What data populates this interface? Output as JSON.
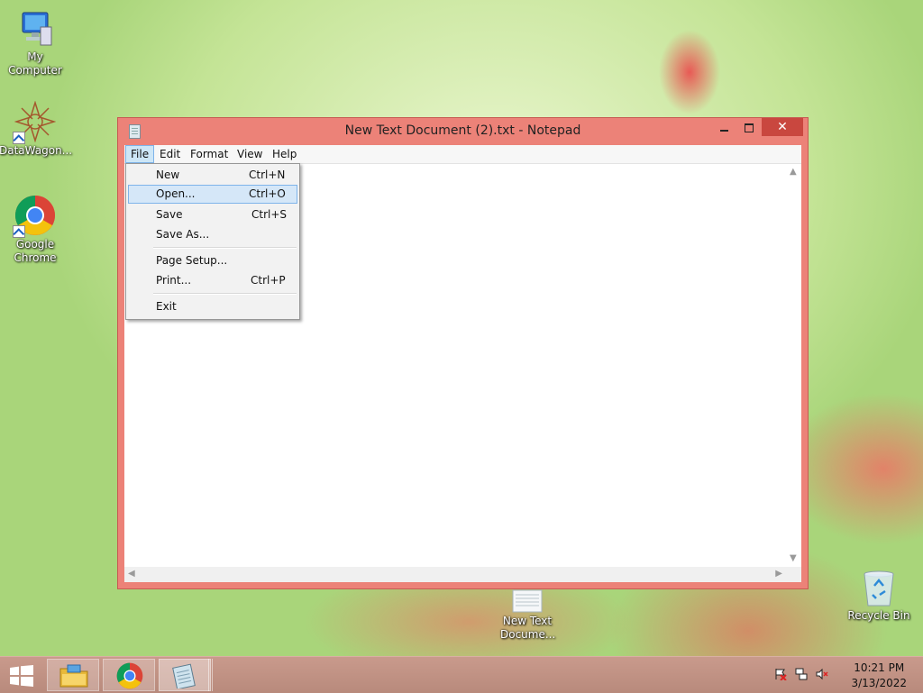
{
  "desktop": {
    "icons": [
      {
        "label": "My Computer",
        "icon": "computer-icon"
      },
      {
        "label": "DataWagon...",
        "icon": "datawagon-icon"
      },
      {
        "label": "Google Chrome",
        "icon": "chrome-icon"
      },
      {
        "label": "New Text Docume...",
        "icon": "text-document-icon"
      },
      {
        "label": "Recycle Bin",
        "icon": "recycle-bin-icon"
      }
    ]
  },
  "window": {
    "title": "New Text Document (2).txt - Notepad",
    "close_glyph": "✕",
    "menubar": [
      "File",
      "Edit",
      "Format",
      "View",
      "Help"
    ],
    "active_menu": "File",
    "editor_content": ""
  },
  "file_menu": {
    "items": [
      {
        "label": "New",
        "shortcut": "Ctrl+N"
      },
      {
        "label": "Open...",
        "shortcut": "Ctrl+O",
        "highlighted": true
      },
      {
        "label": "Save",
        "shortcut": "Ctrl+S"
      },
      {
        "label": "Save As...",
        "shortcut": ""
      },
      {
        "label": "Page Setup...",
        "shortcut": ""
      },
      {
        "label": "Print...",
        "shortcut": "Ctrl+P"
      },
      {
        "label": "Exit",
        "shortcut": ""
      }
    ]
  },
  "taskbar": {
    "buttons": [
      {
        "name": "start",
        "icon": "windows-start-icon"
      },
      {
        "name": "file-explorer",
        "icon": "file-explorer-icon"
      },
      {
        "name": "chrome",
        "icon": "chrome-icon"
      },
      {
        "name": "notepad",
        "icon": "notepad-icon",
        "active": true
      }
    ],
    "tray_icons": [
      "action-center-flag-icon",
      "network-icon",
      "volume-muted-icon"
    ],
    "clock": {
      "time": "10:21 PM",
      "date": "3/13/2022"
    }
  },
  "colors": {
    "window_frame": "#ec8278",
    "close_button": "#c9473f",
    "menu_highlight": "#d5e7f8",
    "taskbar": "#c3948a"
  }
}
